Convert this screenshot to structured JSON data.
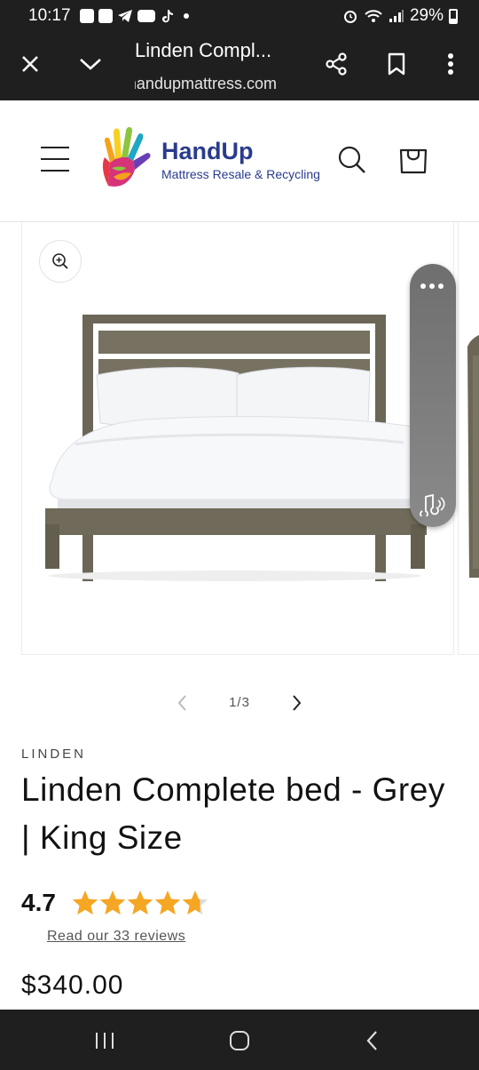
{
  "status_bar": {
    "time": "10:17",
    "battery": "29%",
    "notification_icons": [
      "notes-icon",
      "doc-icon",
      "telegram-icon",
      "youtube-icon",
      "tiktok-icon",
      "dot-icon"
    ],
    "system_icons": [
      "alarm-icon",
      "wifi-icon",
      "signal-icon",
      "battery-icon"
    ]
  },
  "browser": {
    "title": "Linden Compl...",
    "url": "handupmattress.com",
    "buttons": [
      "close-icon",
      "chevron-down-icon",
      "share-icon",
      "bookmark-icon",
      "more-icon"
    ]
  },
  "header": {
    "logo_name": "HandUp",
    "logo_tagline": "Mattress Resale & Recycling",
    "icons": [
      "menu-icon",
      "search-icon",
      "cart-icon"
    ]
  },
  "gallery": {
    "current": 1,
    "total": 3,
    "counter_text": "1/3",
    "zoom_icon": "zoom-in-icon",
    "widget_icons": [
      "more-horizontal-icon",
      "audio-icon"
    ]
  },
  "product": {
    "vendor": "LINDEN",
    "title": "Linden Complete bed - Grey | King Size",
    "rating": "4.7",
    "rating_value": 4.7,
    "rating_max": 5,
    "reviews_link": "Read our 33 reviews",
    "price": "$340.00"
  },
  "colors": {
    "logo_blue": "#2a3b8f",
    "star_orange": "#f5a623",
    "bar_dark": "#1f1f1f"
  }
}
